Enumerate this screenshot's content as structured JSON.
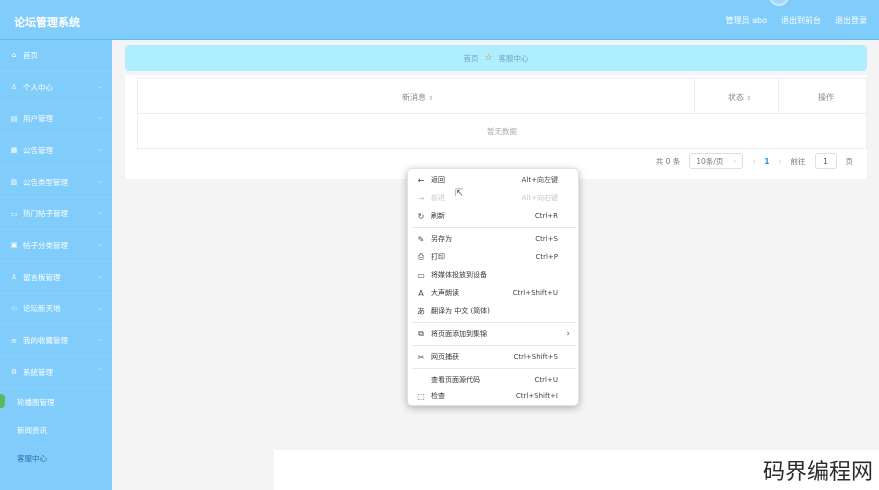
{
  "header": {
    "title": "论坛管理系统",
    "admin_label": "管理员 abo",
    "back_label": "退出到前台",
    "logout_label": "退出登录"
  },
  "sidebar": {
    "items": [
      {
        "label": "首页",
        "icon": "home-icon",
        "glyph": "⌂"
      },
      {
        "label": "个人中心",
        "icon": "person-icon",
        "glyph": "♙"
      },
      {
        "label": "用户管理",
        "icon": "users-icon",
        "glyph": "▤"
      },
      {
        "label": "公告管理",
        "icon": "notice-icon",
        "glyph": "▦"
      },
      {
        "label": "公告类型管理",
        "icon": "chart-icon",
        "glyph": "▥"
      },
      {
        "label": "热门帖子管理",
        "icon": "folder-icon",
        "glyph": "▭"
      },
      {
        "label": "帖子分类管理",
        "icon": "list-icon",
        "glyph": "▣"
      },
      {
        "label": "留言板管理",
        "icon": "message-icon",
        "glyph": "♙"
      },
      {
        "label": "论坛新天地",
        "icon": "forum-icon",
        "glyph": "☉"
      },
      {
        "label": "我的收藏管理",
        "icon": "favorite-icon",
        "glyph": "≡"
      },
      {
        "label": "系统管理",
        "icon": "settings-icon",
        "glyph": "⚙"
      }
    ],
    "sub_items": [
      {
        "label": "轮播图管理"
      },
      {
        "label": "新闻资讯"
      },
      {
        "label": "客服中心"
      }
    ]
  },
  "breadcrumb": {
    "home": "首页",
    "current": "客服中心"
  },
  "table": {
    "columns": [
      "新消息",
      "状态",
      "操作"
    ],
    "empty_text": "暂无数据"
  },
  "pager": {
    "total": "共 0 条",
    "page_size": "10条/页",
    "current_page": "1",
    "goto_label": "前往",
    "goto_value": "1",
    "page_unit": "页"
  },
  "context_menu": {
    "items": [
      {
        "label": "返回",
        "shortcut": "Alt+向左键",
        "glyph": "←",
        "icon": "back-arrow-icon",
        "disabled": false
      },
      {
        "label": "前进",
        "shortcut": "Alt+向右键",
        "glyph": "→",
        "icon": "forward-arrow-icon",
        "disabled": true
      },
      {
        "label": "刷新",
        "shortcut": "Ctrl+R",
        "glyph": "↻",
        "icon": "refresh-icon",
        "disabled": false
      },
      {
        "label": "另存为",
        "shortcut": "Ctrl+S",
        "glyph": "✎",
        "icon": "save-as-icon",
        "disabled": false
      },
      {
        "label": "打印",
        "shortcut": "Ctrl+P",
        "glyph": "⎙",
        "icon": "print-icon",
        "disabled": false
      },
      {
        "label": "将媒体投放到设备",
        "shortcut": "",
        "glyph": "▭",
        "icon": "cast-icon",
        "disabled": false
      },
      {
        "label": "大声朗读",
        "shortcut": "Ctrl+Shift+U",
        "glyph": "A",
        "icon": "read-aloud-icon",
        "disabled": false
      },
      {
        "label": "翻译为 中文 (简体)",
        "shortcut": "",
        "glyph": "あ",
        "icon": "translate-icon",
        "disabled": false
      },
      {
        "label": "将页面添加到集锦",
        "shortcut": "",
        "glyph": "⧉",
        "icon": "collections-icon",
        "disabled": false
      },
      {
        "label": "网页捕获",
        "shortcut": "Ctrl+Shift+S",
        "glyph": "✂",
        "icon": "web-capture-icon",
        "disabled": false
      },
      {
        "label": "查看页面源代码",
        "shortcut": "Ctrl+U",
        "glyph": "",
        "icon": "view-source-icon",
        "disabled": false
      },
      {
        "label": "检查",
        "shortcut": "Ctrl+Shift+I",
        "glyph": "⬚",
        "icon": "inspect-icon",
        "disabled": false
      }
    ],
    "submenu_glyph": "›"
  },
  "watermark": "码界编程网",
  "colors": {
    "sidebar": "#80cdfb",
    "breadcrumb": "#aeeefe",
    "accent": "#2a8fd8"
  }
}
